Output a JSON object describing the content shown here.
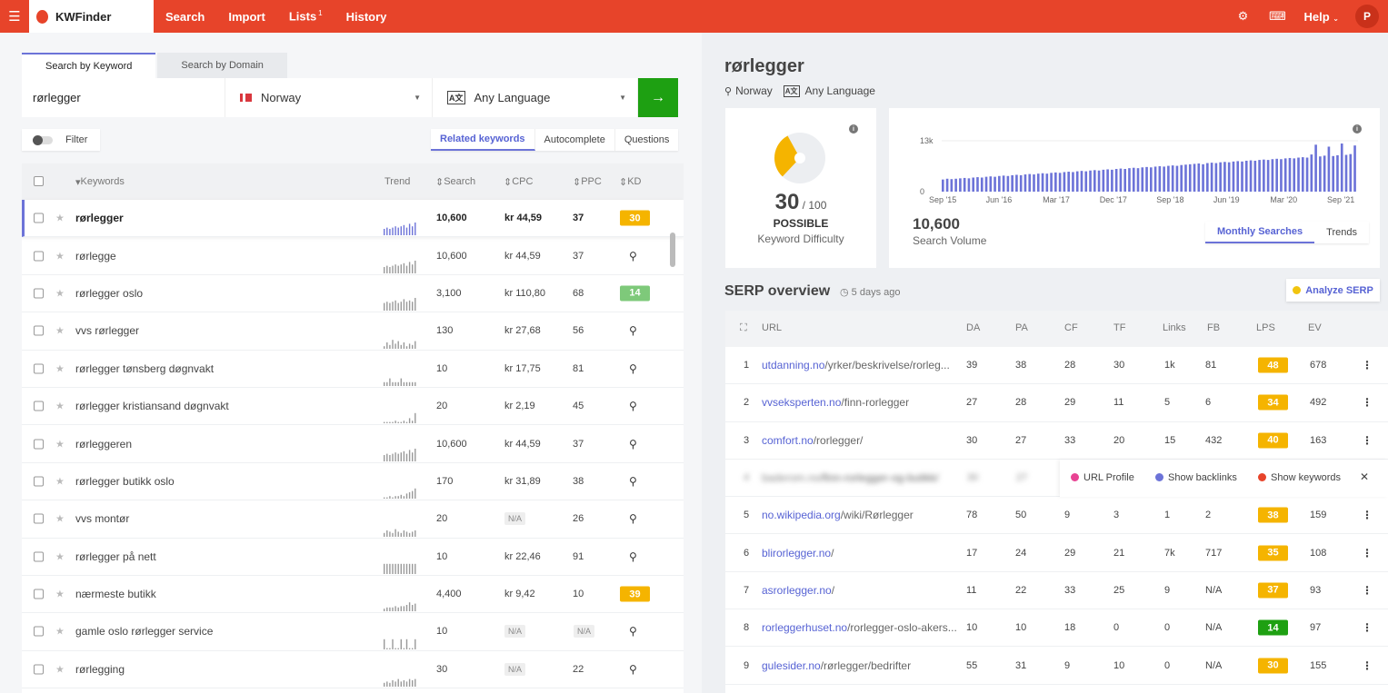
{
  "topbar": {
    "brand": "KWFinder",
    "nav": [
      {
        "label": "Search"
      },
      {
        "label": "Import"
      },
      {
        "label": "Lists",
        "sup": "1"
      },
      {
        "label": "History"
      }
    ],
    "help": "Help",
    "avatar": "P",
    "menu_icon": "hamburger-icon",
    "icons": [
      "settings-icon",
      "keyboard-icon"
    ],
    "brand_color": "#e7442a"
  },
  "search": {
    "tabs": [
      "Search by Keyword",
      "Search by Domain"
    ],
    "active_tab": 0,
    "keyword": "rørlegger",
    "location": "Norway",
    "language": "Any Language",
    "go_icon": "arrow-right-icon",
    "filter_label": "Filter",
    "modes": [
      "Related keywords",
      "Autocomplete",
      "Questions"
    ],
    "active_mode": 0
  },
  "table": {
    "headers": {
      "keywords": "Keywords",
      "trend": "Trend",
      "search": "Search",
      "cpc": "CPC",
      "ppc": "PPC",
      "kd": "KD"
    },
    "rows": [
      {
        "keyword": "rørlegger",
        "search": "10,600",
        "cpc": "kr 44,59",
        "ppc": "37",
        "kd": "30",
        "kd_color": "#f5b400",
        "trend": [
          0.5,
          0.6,
          0.5,
          0.6,
          0.7,
          0.6,
          0.7,
          0.8,
          0.6,
          0.9,
          0.7,
          1
        ],
        "selected": true
      },
      {
        "keyword": "rørlegge",
        "search": "10,600",
        "cpc": "kr 44,59",
        "ppc": "37",
        "kd": "",
        "trend": [
          0.5,
          0.6,
          0.5,
          0.6,
          0.7,
          0.6,
          0.7,
          0.8,
          0.6,
          0.9,
          0.7,
          1
        ]
      },
      {
        "keyword": "rørlegger oslo",
        "search": "3,100",
        "cpc": "kr 110,80",
        "ppc": "68",
        "kd": "14",
        "kd_color": "#7ec97a",
        "trend": [
          0.6,
          0.7,
          0.6,
          0.7,
          0.8,
          0.6,
          0.7,
          0.9,
          0.7,
          0.8,
          0.7,
          1
        ]
      },
      {
        "keyword": "vvs rørlegger",
        "search": "130",
        "cpc": "kr 27,68",
        "ppc": "56",
        "kd": "",
        "trend": [
          0.2,
          0.5,
          0.3,
          0.7,
          0.4,
          0.6,
          0.3,
          0.5,
          0.2,
          0.4,
          0.3,
          0.6
        ]
      },
      {
        "keyword": "rørlegger tønsberg døgnvakt",
        "search": "10",
        "cpc": "kr 17,75",
        "ppc": "81",
        "kd": "",
        "trend": [
          0.3,
          0.3,
          0.6,
          0.3,
          0.3,
          0.3,
          0.6,
          0.3,
          0.3,
          0.3,
          0.3,
          0.3
        ]
      },
      {
        "keyword": "rørlegger kristiansand døgnvakt",
        "search": "20",
        "cpc": "kr 2,19",
        "ppc": "45",
        "kd": "",
        "trend": [
          0.1,
          0.1,
          0.1,
          0.1,
          0.2,
          0.1,
          0.1,
          0.2,
          0.1,
          0.4,
          0.2,
          0.8
        ]
      },
      {
        "keyword": "rørleggeren",
        "search": "10,600",
        "cpc": "kr 44,59",
        "ppc": "37",
        "kd": "",
        "trend": [
          0.5,
          0.6,
          0.5,
          0.6,
          0.7,
          0.6,
          0.7,
          0.8,
          0.6,
          0.9,
          0.7,
          1
        ]
      },
      {
        "keyword": "rørlegger butikk oslo",
        "search": "170",
        "cpc": "kr 31,89",
        "ppc": "38",
        "kd": "",
        "trend": [
          0.1,
          0.1,
          0.2,
          0.1,
          0.2,
          0.2,
          0.3,
          0.2,
          0.4,
          0.5,
          0.6,
          0.8
        ]
      },
      {
        "keyword": "vvs montør",
        "search": "20",
        "cpc": "N/A",
        "ppc": "26",
        "kd": "",
        "trend": [
          0.3,
          0.5,
          0.4,
          0.3,
          0.6,
          0.4,
          0.3,
          0.5,
          0.4,
          0.3,
          0.4,
          0.5
        ]
      },
      {
        "keyword": "rørlegger på nett",
        "search": "10",
        "cpc": "kr 22,46",
        "ppc": "91",
        "kd": "",
        "trend": [
          0.8,
          0.8,
          0.8,
          0.8,
          0.8,
          0.8,
          0.8,
          0.8,
          0.8,
          0.8,
          0.8,
          0.8
        ]
      },
      {
        "keyword": "nærmeste butikk",
        "search": "4,400",
        "cpc": "kr 9,42",
        "ppc": "10",
        "kd": "39",
        "kd_color": "#f5b400",
        "trend": [
          0.2,
          0.3,
          0.3,
          0.3,
          0.4,
          0.3,
          0.4,
          0.4,
          0.5,
          0.7,
          0.5,
          0.6
        ]
      },
      {
        "keyword": "gamle oslo rørlegger service",
        "search": "10",
        "cpc": "N/A",
        "ppc": "N/A",
        "kd": "",
        "trend": [
          0.8,
          0.1,
          0.1,
          0.8,
          0.1,
          0.1,
          0.8,
          0.1,
          0.8,
          0.1,
          0.1,
          0.8
        ]
      },
      {
        "keyword": "rørlegging",
        "search": "30",
        "cpc": "N/A",
        "ppc": "22",
        "kd": "",
        "trend": [
          0.3,
          0.4,
          0.3,
          0.5,
          0.4,
          0.6,
          0.4,
          0.5,
          0.4,
          0.6,
          0.5,
          0.6
        ]
      }
    ]
  },
  "detail": {
    "keyword": "rørlegger",
    "location": "Norway",
    "language": "Any Language",
    "kd": {
      "value": "30",
      "max": "/ 100",
      "label": "POSSIBLE",
      "caption": "Keyword Difficulty",
      "fraction": 0.3,
      "color": "#f5b400"
    },
    "volume": {
      "value": "10,600",
      "caption": "Search Volume",
      "tabs": [
        "Monthly Searches",
        "Trends"
      ],
      "active_tab": 0
    }
  },
  "chart_data": {
    "type": "bar",
    "ylim": [
      0,
      13000
    ],
    "yticks": [
      "0",
      "13k"
    ],
    "xtick_labels": [
      "Sep '15",
      "Jun '16",
      "Mar '17",
      "Dec '17",
      "Sep '18",
      "Jun '19",
      "Mar '20",
      "Sep '21"
    ],
    "color": "#6c73d8",
    "values": [
      3100,
      3300,
      3200,
      3300,
      3400,
      3500,
      3400,
      3600,
      3700,
      3600,
      3800,
      3900,
      3800,
      4000,
      4100,
      4000,
      4200,
      4300,
      4200,
      4400,
      4500,
      4400,
      4600,
      4700,
      4600,
      4800,
      4900,
      4800,
      5000,
      5100,
      5000,
      5200,
      5300,
      5200,
      5400,
      5500,
      5400,
      5600,
      5700,
      5600,
      5800,
      5900,
      5800,
      6000,
      6100,
      6000,
      6200,
      6300,
      6200,
      6400,
      6500,
      6400,
      6600,
      6700,
      6600,
      6800,
      6900,
      7000,
      7100,
      7200,
      7000,
      7300,
      7400,
      7300,
      7500,
      7600,
      7500,
      7700,
      7800,
      7700,
      7900,
      8000,
      7900,
      8100,
      8200,
      8100,
      8300,
      8400,
      8300,
      8500,
      8600,
      8500,
      8700,
      8800,
      8700,
      9500,
      12000,
      9000,
      9200,
      11500,
      9100,
      9300,
      12300,
      9400,
      9600,
      11800
    ]
  },
  "serp": {
    "title": "SERP overview",
    "updated": "5 days ago",
    "analyze": "Analyze SERP",
    "headers": {
      "url": "URL",
      "da": "DA",
      "pa": "PA",
      "cf": "CF",
      "tf": "TF",
      "links": "Links",
      "fb": "FB",
      "lps": "LPS",
      "ev": "EV"
    },
    "rows": [
      {
        "rank": "1",
        "domain": "utdanning.no",
        "path": "/yrker/beskrivelse/rorleg...",
        "da": "39",
        "pa": "38",
        "cf": "28",
        "tf": "30",
        "links": "1k",
        "fb": "81",
        "lps": "48",
        "lps_color": "#f5b400",
        "ev": "678"
      },
      {
        "rank": "2",
        "domain": "vvseksperten.no",
        "path": "/finn-rorlegger",
        "da": "27",
        "pa": "28",
        "cf": "29",
        "tf": "11",
        "links": "5",
        "fb": "6",
        "lps": "34",
        "lps_color": "#f5b400",
        "ev": "492"
      },
      {
        "rank": "3",
        "domain": "comfort.no",
        "path": "/rorlegger/",
        "da": "30",
        "pa": "27",
        "cf": "33",
        "tf": "20",
        "links": "15",
        "fb": "432",
        "lps": "40",
        "lps_color": "#f5b400",
        "ev": "163"
      },
      {
        "rank": "4",
        "domain": "baderom.no",
        "path": "/finn-rorlegger-og-butikk/",
        "da": "30",
        "pa": "27",
        "hover": true
      },
      {
        "rank": "5",
        "domain": "no.wikipedia.org",
        "path": "/wiki/Rørlegger",
        "da": "78",
        "pa": "50",
        "cf": "9",
        "tf": "3",
        "links": "1",
        "fb": "2",
        "lps": "38",
        "lps_color": "#f5b400",
        "ev": "159"
      },
      {
        "rank": "6",
        "domain": "blirorlegger.no",
        "path": "/",
        "da": "17",
        "pa": "24",
        "cf": "29",
        "tf": "21",
        "links": "7k",
        "fb": "717",
        "lps": "35",
        "lps_color": "#f5b400",
        "ev": "108"
      },
      {
        "rank": "7",
        "domain": "asrorlegger.no",
        "path": "/",
        "da": "11",
        "pa": "22",
        "cf": "33",
        "tf": "25",
        "links": "9",
        "fb": "N/A",
        "lps": "37",
        "lps_color": "#f5b400",
        "ev": "93"
      },
      {
        "rank": "8",
        "domain": "rorleggerhuset.no",
        "path": "/rorlegger-oslo-akers...",
        "da": "10",
        "pa": "10",
        "cf": "18",
        "tf": "0",
        "links": "0",
        "fb": "N/A",
        "lps": "14",
        "lps_color": "#1ea012",
        "ev": "97"
      },
      {
        "rank": "9",
        "domain": "gulesider.no",
        "path": "/rørlegger/bedrifter",
        "da": "55",
        "pa": "31",
        "cf": "9",
        "tf": "10",
        "links": "0",
        "fb": "N/A",
        "lps": "30",
        "lps_color": "#f5b400",
        "ev": "155"
      }
    ],
    "actions": [
      {
        "label": "URL Profile",
        "color": "#e84393"
      },
      {
        "label": "Show backlinks",
        "color": "#6c73d8"
      },
      {
        "label": "Show keywords",
        "color": "#e7442a"
      }
    ]
  }
}
